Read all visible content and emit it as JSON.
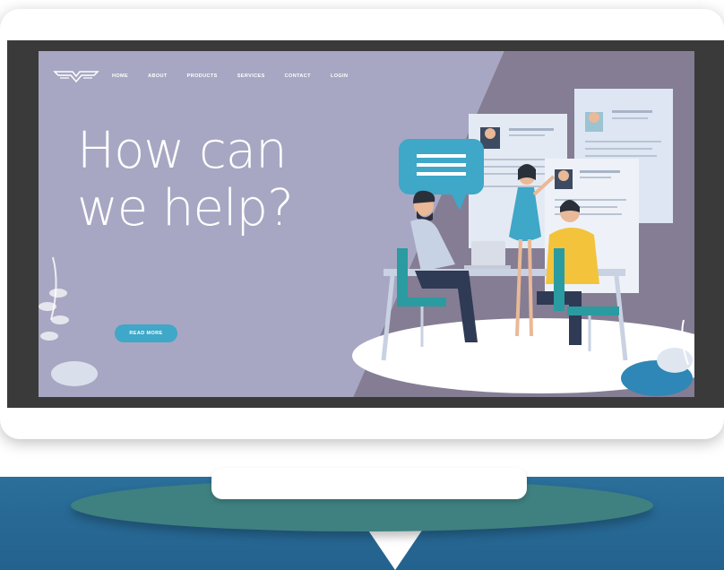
{
  "nav": {
    "items": [
      "HOME",
      "ABOUT",
      "PRODUCTS",
      "SERVICES",
      "CONTACT",
      "LOGIN"
    ]
  },
  "hero": {
    "line1": "How can",
    "line2": "we help?",
    "cta_label": "READ MORE"
  },
  "colors": {
    "screen_bg": "#a7a7c3",
    "accent": "#3fa7c7",
    "band": "#2a6f9a"
  },
  "icons": [
    "logo-wings-icon",
    "speech-bubble-icon",
    "laptop-icon",
    "plant-icon"
  ]
}
